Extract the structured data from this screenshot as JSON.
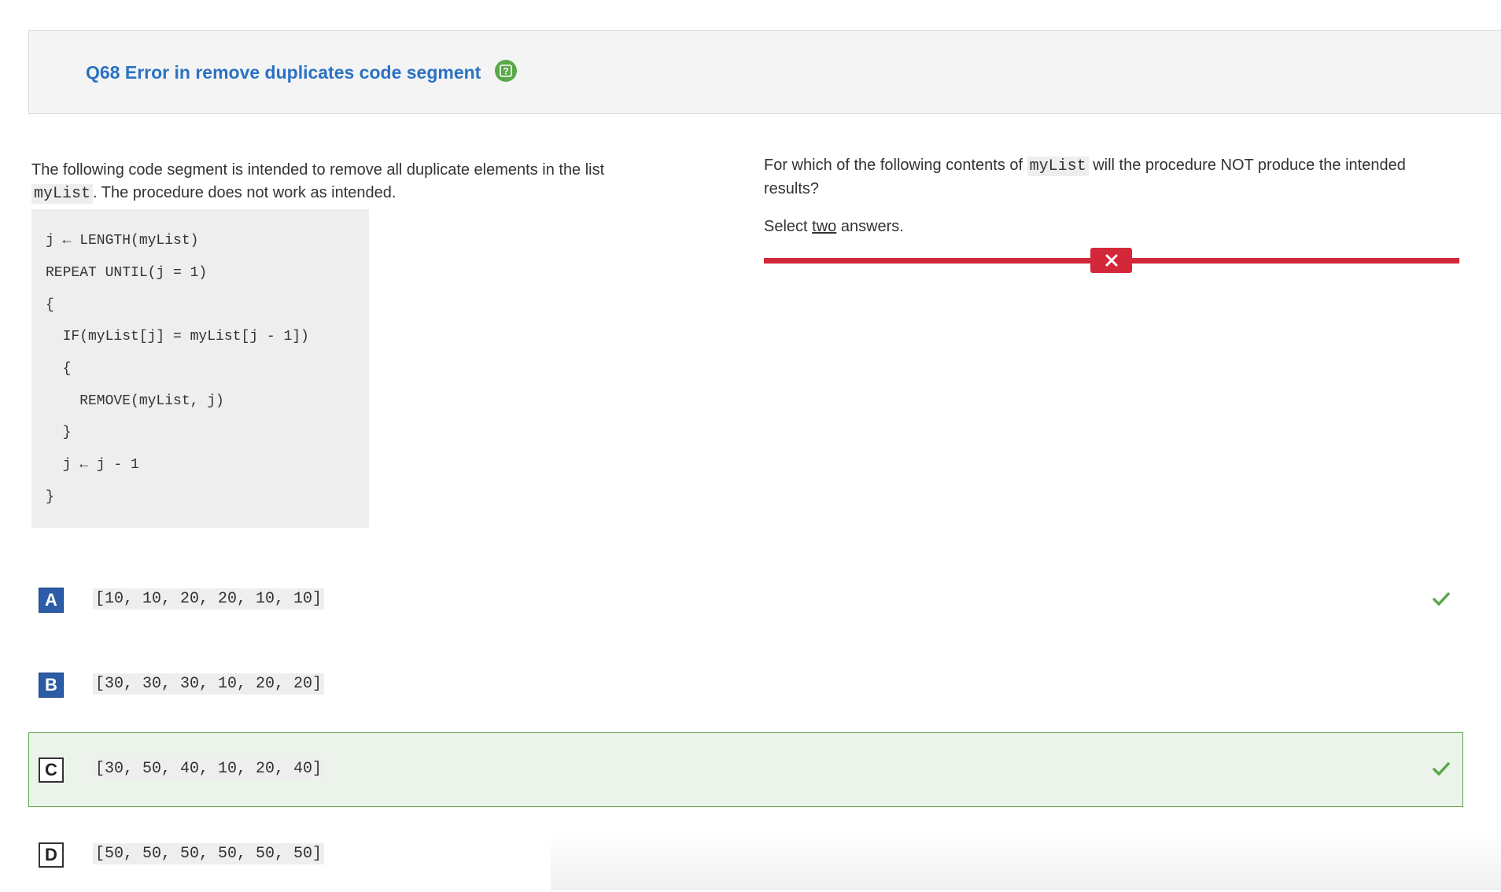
{
  "question": {
    "title": "Q68 Error in remove duplicates code segment",
    "help_icon": "question-mark-icon"
  },
  "stem": {
    "text_before": "The following code segment is intended to remove all duplicate elements in the list ",
    "code_var": "myList",
    "text_after": ".  The procedure does not work as intended."
  },
  "code": [
    "j ← LENGTH(myList)",
    "REPEAT UNTIL(j = 1)",
    "{",
    "  IF(myList[j] = myList[j - 1])",
    "  {",
    "    REMOVE(myList, j)",
    "  }",
    "  j ← j - 1",
    "}"
  ],
  "prompt": {
    "text_before": "For which of the following contents of ",
    "code_var": "myList",
    "text_after": "  will the procedure NOT produce the intended results?"
  },
  "select_instruction": {
    "before": "Select ",
    "emphasis": "two",
    "after": " answers."
  },
  "status": {
    "result_icon": "x-icon",
    "color": "#d3283a"
  },
  "options": [
    {
      "letter": "A",
      "text": "[10, 10, 20, 20, 10, 10]",
      "selected": true,
      "correct": true
    },
    {
      "letter": "B",
      "text": "[30, 30, 30, 10, 20, 20]",
      "selected": true,
      "correct": false
    },
    {
      "letter": "C",
      "text": "[30, 50, 40, 10, 20, 40]",
      "selected": false,
      "correct": true
    },
    {
      "letter": "D",
      "text": "[50, 50, 50, 50, 50, 50]",
      "selected": false,
      "correct": false
    }
  ],
  "colors": {
    "accent": "#2a72c4",
    "correct": "#5aa84a",
    "selected": "#2a5ca8",
    "incorrect": "#d3283a"
  }
}
